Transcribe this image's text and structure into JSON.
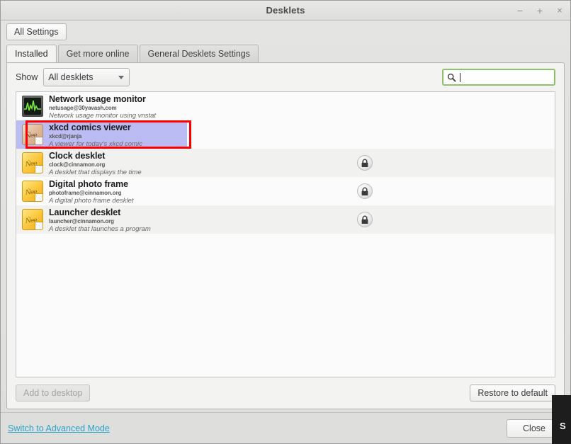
{
  "window": {
    "title": "Desklets",
    "buttons": {
      "minimize": "−",
      "maximize": "+",
      "close": "×"
    }
  },
  "toolbar": {
    "all_settings_label": "All Settings"
  },
  "tabs": [
    {
      "label": "Installed",
      "active": true
    },
    {
      "label": "Get more online",
      "active": false
    },
    {
      "label": "General Desklets Settings",
      "active": false
    }
  ],
  "filter": {
    "show_label": "Show",
    "combo_value": "All desklets",
    "combo_options": [
      "All desklets"
    ],
    "search_value": "",
    "search_placeholder": ""
  },
  "list": [
    {
      "name": "Network usage monitor",
      "uuid": "netusage@30yavash.com",
      "description": "Network usage monitor using vnstat",
      "icon": "network-monitor-icon",
      "locked": false,
      "selected": false
    },
    {
      "name": "xkcd comics viewer",
      "uuid": "xkcd@rjanja",
      "description": "A viewer for today's xkcd comic",
      "icon": "xkcd-desklet-icon",
      "locked": false,
      "selected": true
    },
    {
      "name": "Clock desklet",
      "uuid": "clock@cinnamon.org",
      "description": "A desklet that displays the time",
      "icon": "desklet-icon",
      "locked": true,
      "selected": false
    },
    {
      "name": "Digital photo frame",
      "uuid": "photoframe@cinnamon.org",
      "description": "A digital photo frame desklet",
      "icon": "desklet-icon",
      "locked": true,
      "selected": false
    },
    {
      "name": "Launcher desklet",
      "uuid": "launcher@cinnamon.org",
      "description": "A desklet that launches a program",
      "icon": "desklet-icon",
      "locked": true,
      "selected": false
    }
  ],
  "actions": {
    "add_to_desktop_label": "Add to desktop",
    "add_to_desktop_enabled": false,
    "restore_to_default_label": "Restore to default"
  },
  "footer": {
    "advanced_mode_label": "Switch to Advanced Mode",
    "close_label": "Close"
  },
  "overlay": {
    "text": "S"
  },
  "colors": {
    "selection": "#bcbcf4",
    "annotation": "#ff0000",
    "search_focus_border": "#8fc06a",
    "link": "#2aa3c7"
  }
}
